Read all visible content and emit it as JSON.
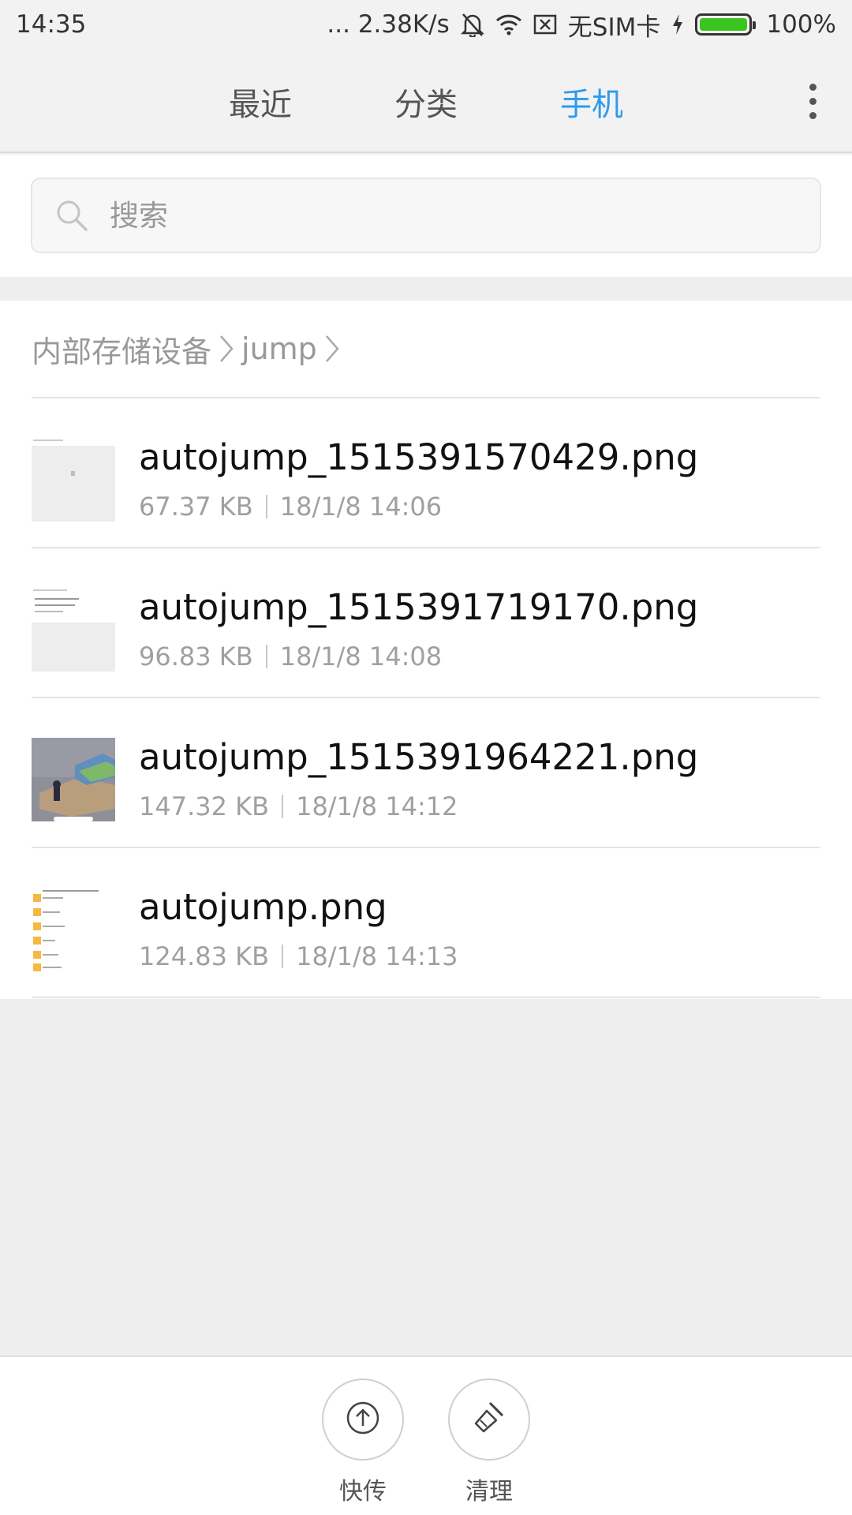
{
  "status_bar": {
    "time": "14:35",
    "network_speed": "... 2.38K/s",
    "sim_status": "无SIM卡",
    "battery": "100%"
  },
  "tabs": [
    {
      "label": "最近",
      "active": false
    },
    {
      "label": "分类",
      "active": false
    },
    {
      "label": "手机",
      "active": true
    }
  ],
  "search": {
    "placeholder": "搜索"
  },
  "breadcrumb": [
    "内部存储设备",
    "jump"
  ],
  "files": [
    {
      "name": "autojump_1515391570429.png",
      "size": "67.37 KB",
      "date": "18/1/8 14:06"
    },
    {
      "name": "autojump_1515391719170.png",
      "size": "96.83 KB",
      "date": "18/1/8 14:08"
    },
    {
      "name": "autojump_1515391964221.png",
      "size": "147.32 KB",
      "date": "18/1/8 14:12"
    },
    {
      "name": "autojump.png",
      "size": "124.83 KB",
      "date": "18/1/8 14:13"
    }
  ],
  "bottom_actions": [
    {
      "label": "快传",
      "icon": "upload-icon"
    },
    {
      "label": "清理",
      "icon": "broom-icon"
    }
  ],
  "colors": {
    "accent": "#2f9bec",
    "battery": "#3cc41f"
  }
}
